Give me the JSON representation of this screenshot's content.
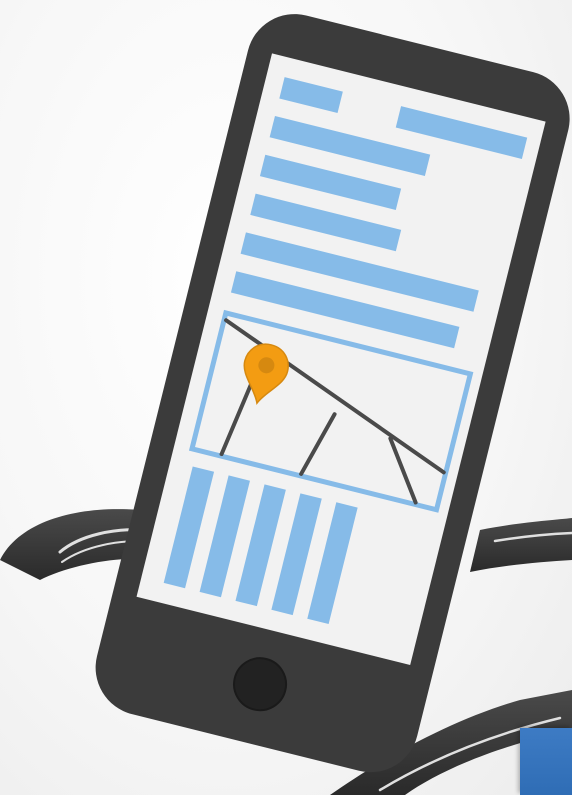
{
  "colors": {
    "road": "#3a3a3a",
    "road_line": "#d9d9d9",
    "phone_body": "#3b3b3b",
    "screen": "#f2f2f2",
    "content_bar": "#86bbe8",
    "map_frame": "#86bbe8",
    "map_street": "#4a4a4a",
    "pin": "#f39c12",
    "pin_dark": "#d68910",
    "corner_tile": "#2f6db5"
  },
  "icons": {
    "map_marker": "map-pin-icon",
    "home_button": "home-button"
  }
}
